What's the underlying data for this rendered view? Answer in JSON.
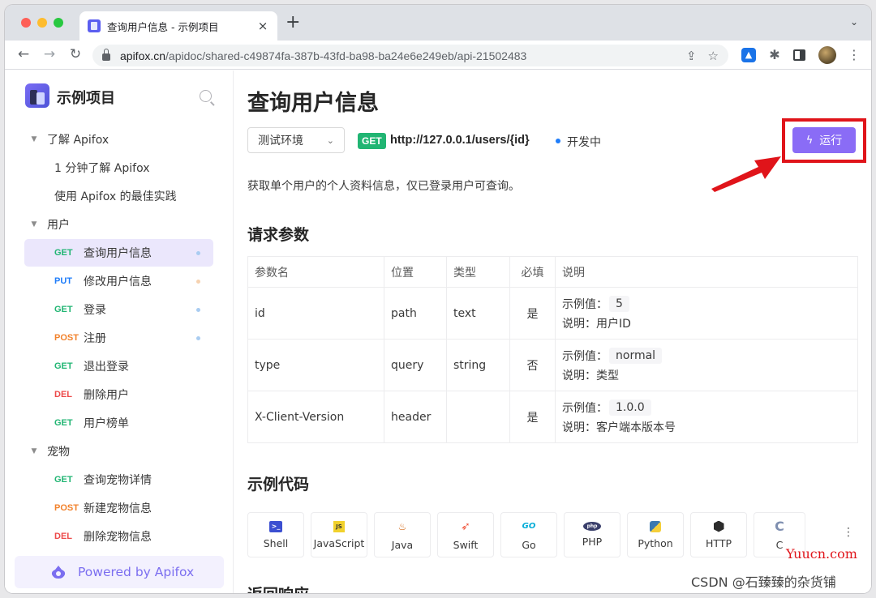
{
  "browser": {
    "tab_title": "查询用户信息 - 示例项目",
    "tab_close": "×",
    "new_tab": "+",
    "tab_menu": "⌄",
    "url_host": "apifox.cn",
    "url_path": "/apidoc/shared-c49874fa-387b-43fd-ba98-ba24e6e249eb/api-21502483",
    "nav_back": "←",
    "nav_forward": "→",
    "nav_reload": "↻",
    "share_icon": "⇪",
    "bookmark_icon": "☆",
    "ext_icon_label": "▲",
    "puzzle_icon": "✱",
    "menu_icon": "⋮"
  },
  "sidebar": {
    "project_name": "示例项目",
    "groups": [
      {
        "label": "了解 Apifox",
        "caret": "▼"
      },
      {
        "label": "用户",
        "caret": "▼"
      },
      {
        "label": "宠物",
        "caret": "▼"
      }
    ],
    "docs": [
      {
        "label": "1 分钟了解 Apifox"
      },
      {
        "label": "使用 Apifox 的最佳实践"
      }
    ],
    "user_apis": [
      {
        "method": "GET",
        "label": "查询用户信息"
      },
      {
        "method": "PUT",
        "label": "修改用户信息"
      },
      {
        "method": "GET",
        "label": "登录"
      },
      {
        "method": "POST",
        "label": "注册"
      },
      {
        "method": "GET",
        "label": "退出登录"
      },
      {
        "method": "DEL",
        "label": "删除用户"
      },
      {
        "method": "GET",
        "label": "用户榜单"
      }
    ],
    "pet_apis": [
      {
        "method": "GET",
        "label": "查询宠物详情"
      },
      {
        "method": "POST",
        "label": "新建宠物信息"
      },
      {
        "method": "DEL",
        "label": "删除宠物信息"
      }
    ],
    "powered_by": "Powered by Apifox"
  },
  "main": {
    "title": "查询用户信息",
    "environment": "测试环境",
    "chevron": "⌄",
    "method": "GET",
    "endpoint": "http://127.0.0.1/users/{id}",
    "status": "开发中",
    "run_icon": "ϟ",
    "run_label": "运行",
    "description": "获取单个用户的个人资料信息，仅已登录用户可查询。",
    "params_title": "请求参数",
    "params_headers": [
      "参数名",
      "位置",
      "类型",
      "必填",
      "说明"
    ],
    "example_label": "示例值：",
    "desc_label": "说明：",
    "params": [
      {
        "name": "id",
        "in": "path",
        "type": "text",
        "required": "是",
        "example": "5",
        "desc": "用户ID"
      },
      {
        "name": "type",
        "in": "query",
        "type": "string",
        "required": "否",
        "example": "normal",
        "desc": "类型"
      },
      {
        "name": "X-Client-Version",
        "in": "header",
        "type": "",
        "required": "是",
        "example": "1.0.0",
        "desc": "客户端本版本号"
      }
    ],
    "code_title": "示例代码",
    "languages": [
      {
        "label": "Shell",
        "icon": ">_"
      },
      {
        "label": "JavaScript",
        "icon": "JS"
      },
      {
        "label": "Java",
        "icon": "♨"
      },
      {
        "label": "Swift",
        "icon": "➶"
      },
      {
        "label": "Go",
        "icon": "GO"
      },
      {
        "label": "PHP",
        "icon": "php"
      },
      {
        "label": "Python",
        "icon": ""
      },
      {
        "label": "HTTP",
        "icon": ""
      },
      {
        "label": "C",
        "icon": "C"
      }
    ],
    "more_icon": "⋮",
    "response_title": "返回响应"
  },
  "watermarks": {
    "site": "Yuucn.com",
    "csdn": "CSDN @石臻臻的杂货铺"
  },
  "colors": {
    "accent": "#8a6cf6",
    "get": "#21b573",
    "put": "#1f7dfa",
    "post": "#f2822c",
    "del": "#ed4a4a",
    "highlight": "#e0141a"
  }
}
